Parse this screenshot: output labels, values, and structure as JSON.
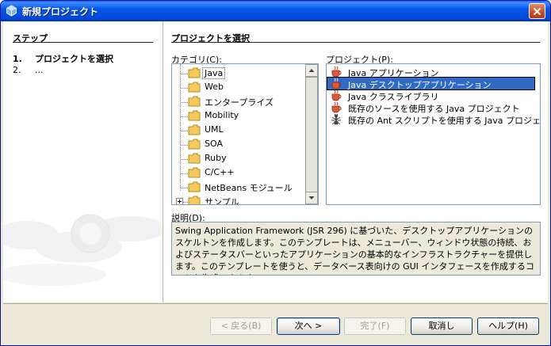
{
  "window": {
    "title": "新規プロジェクト"
  },
  "steps": {
    "header": "ステップ",
    "items": [
      {
        "num": "1.",
        "label": "プロジェクトを選択"
      },
      {
        "num": "2.",
        "label": "..."
      }
    ]
  },
  "main": {
    "header": "プロジェクトを選択",
    "categories_label": "カテゴリ(C):",
    "projects_label": "プロジェクト(P):",
    "description_label": "説明(D):"
  },
  "categories": [
    "Java",
    "Web",
    "エンタープライズ",
    "Mobility",
    "UML",
    "SOA",
    "Ruby",
    "C/C++",
    "NetBeans モジュール",
    "サンプル"
  ],
  "projects": [
    {
      "label": "Java アプリケーション",
      "icon": "java-cup-icon"
    },
    {
      "label": "Java デスクトップアプリケーション",
      "icon": "java-cup-icon"
    },
    {
      "label": "Java クラスライブラリ",
      "icon": "java-cup-icon"
    },
    {
      "label": "既存のソースを使用する Java プロジェクト",
      "icon": "java-cup-icon"
    },
    {
      "label": "既存の Ant スクリプトを使用する Java プロジェクト",
      "icon": "ant-icon"
    }
  ],
  "description": "Swing Application Framework (JSR 296) に基づいた、デスクトップアプリケーションのスケルトンを作成します。このテンプレートは、メニューバー、ウィンドウ状態の持続、およびステータスバーといったアプリケーションの基本的なインフラストラクチャーを提供します。このテンプレートを使うと、データベース表向けの GUI インタフェースを作成するコードも生成できます。",
  "buttons": {
    "back": "< 戻る(B)",
    "next": "次へ >",
    "finish": "完了(F)",
    "cancel": "取消し",
    "help": "ヘルプ(H)"
  },
  "colors": {
    "selection": "#316ac5",
    "titlebar": "#0054e3"
  }
}
